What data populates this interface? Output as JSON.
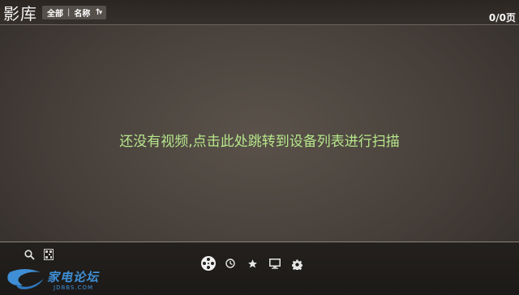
{
  "header": {
    "title": "影库",
    "filter": {
      "all_label": "全部",
      "separator": "|",
      "sort_label": "名称",
      "sort_arrow": "↑"
    },
    "dropdown_glyph": "▾",
    "page_count": "0/0页"
  },
  "main": {
    "empty_message": "还没有视频,点击此处跳转到设备列表进行扫描"
  },
  "bottom_bar": {
    "left_icons": [
      "search-icon",
      "qr-code-icon"
    ],
    "center_icons": [
      "film-reel-icon",
      "history-icon",
      "star-icon",
      "monitor-icon",
      "gear-icon"
    ]
  },
  "watermark": {
    "text": "家电论坛",
    "sub": "JDBBS.COM"
  },
  "colors": {
    "accent_message": "#b6e68a",
    "watermark": "#3f8fd6"
  }
}
